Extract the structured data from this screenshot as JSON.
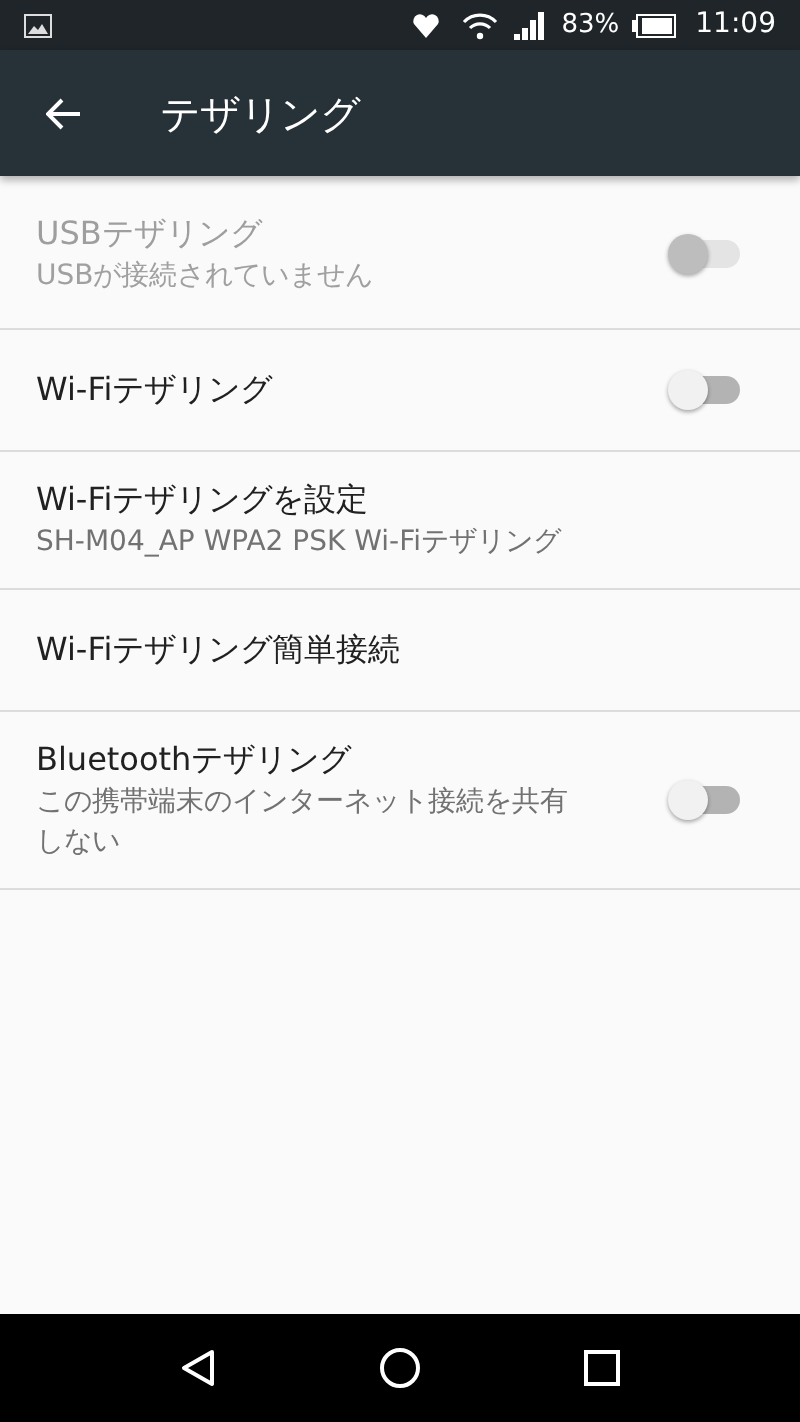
{
  "status_bar": {
    "battery": "83%",
    "time": "11:09"
  },
  "app_bar": {
    "title": "テザリング"
  },
  "items": [
    {
      "kind": "switch",
      "title": "USBテザリング",
      "subtitle": "USBが接続されていません",
      "disabled": true,
      "on": false
    },
    {
      "kind": "switch",
      "title": "Wi-Fiテザリング",
      "disabled": false,
      "on": false
    },
    {
      "kind": "plain",
      "title": "Wi-Fiテザリングを設定",
      "subtitle": "SH-M04_AP WPA2 PSK Wi-Fiテザリング",
      "disabled": false
    },
    {
      "kind": "plain",
      "title": "Wi-Fiテザリング簡単接続",
      "disabled": false
    },
    {
      "kind": "switch",
      "title": "Bluetoothテザリング",
      "subtitle": "この携帯端末のインターネット接続を共有しない",
      "disabled": false,
      "on": false
    }
  ]
}
